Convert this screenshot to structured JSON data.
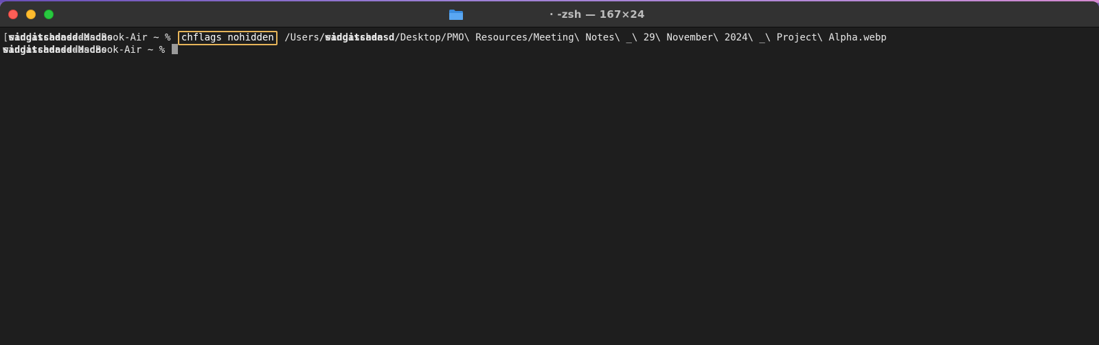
{
  "window": {
    "title": "· -zsh — 167×24",
    "folder_icon": "folder-icon",
    "colors": {
      "background": "#1e1e1e",
      "titlebar": "#323232",
      "highlight": "#e8b65a",
      "close": "#fe5f57",
      "minimize": "#febc2e",
      "zoom": "#28c840"
    }
  },
  "terminal": {
    "line1": {
      "bracket": "[",
      "user_a": "sidgitsadasd",
      "user_b": "wandaschandsdasdas",
      "host": "-MacBook-Air ~ %",
      "command": "chflags nohidden",
      "path_a": "/Users/",
      "path_user_a": "sidgitsadasd",
      "path_user_b": "wandaschan",
      "path_rest": "/Desktop/PMO\\ Resources/Meeting\\ Notes\\ _\\ 29\\ November\\ 2024\\ _\\ Project\\ Alpha.webp"
    },
    "line2": {
      "user_a": "sidgitsadasd",
      "user_b": "wandaschandsdasdas",
      "host": "-MacBook-Air ~ %"
    }
  }
}
